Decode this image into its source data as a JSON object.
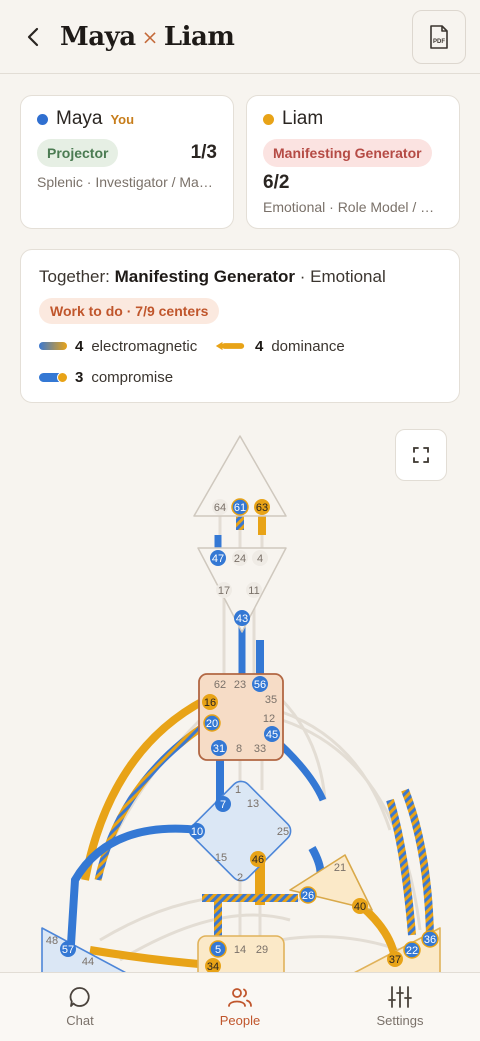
{
  "header": {
    "back_icon": "chevron-left-icon",
    "name_a": "Maya",
    "separator": "×",
    "name_b": "Liam",
    "pdf_label": "PDF"
  },
  "maya": {
    "name": "Maya",
    "you_tag": "You",
    "type": "Projector",
    "profile": "1/3",
    "details": "Splenic · Investigator / Ma…",
    "color": "#2f6fd0"
  },
  "liam": {
    "name": "Liam",
    "type": "Manifesting Generator",
    "profile": "6/2",
    "details": "Emotional · Role Model / …",
    "color": "#e8a317"
  },
  "together": {
    "prefix": "Together: ",
    "type": "Manifesting Generator",
    "authority": " · Emotional",
    "work_badge": "Work to do · 7/9 centers",
    "electromagnetic_count": "4",
    "electromagnetic_label": "electromagnetic",
    "dominance_count": "4",
    "dominance_label": "dominance",
    "compromise_count": "3",
    "compromise_label": "compromise"
  },
  "bodygraph": {
    "head_gates": [
      "64",
      "61",
      "63"
    ],
    "ajna_gates": [
      "47",
      "24",
      "4",
      "17",
      "11",
      "43"
    ],
    "throat_gates": [
      "62",
      "23",
      "56",
      "35",
      "16",
      "12",
      "20",
      "45",
      "31",
      "8",
      "33"
    ],
    "g_gates": [
      "1",
      "13",
      "7",
      "25",
      "10",
      "15",
      "46",
      "2"
    ],
    "ego_gates": [
      "21",
      "26",
      "40"
    ],
    "spleen_gates": [
      "48",
      "57",
      "44"
    ],
    "sacral_gates": [
      "5",
      "14",
      "29",
      "34"
    ],
    "solar_gates": [
      "36",
      "22",
      "37"
    ]
  },
  "nav": {
    "chat": "Chat",
    "people": "People",
    "settings": "Settings"
  }
}
